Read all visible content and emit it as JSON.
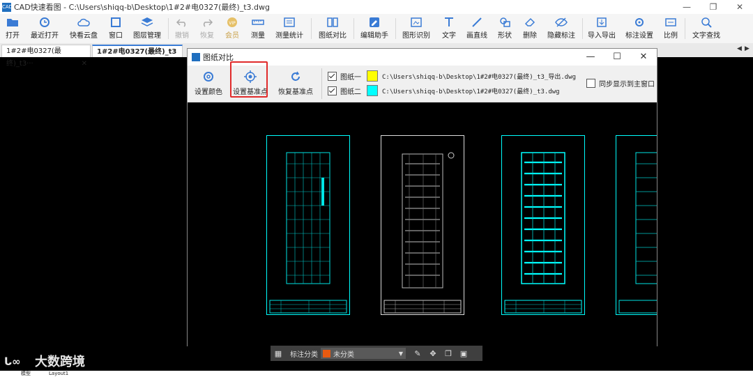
{
  "app": {
    "logo": "CAD",
    "title": "CAD快速看图 - C:\\Users\\shiqq-b\\Desktop\\1#2#电0327(最终)_t3.dwg",
    "window_controls": [
      "—",
      "❐",
      "✕"
    ]
  },
  "toolbar": {
    "open": "打开",
    "recent": "最近打开",
    "cloud": "快看云盘",
    "window": "窗口",
    "layers": "图层管理",
    "undo": "撤销",
    "redo": "恢复",
    "vip": "会员",
    "measure": "测量",
    "measure_stats": "测量统计",
    "compare": "图纸对比",
    "edit_helper": "编辑助手",
    "shape_recog": "图形识别",
    "text": "文字",
    "line": "画直线",
    "shape": "形状",
    "delete": "删除",
    "hide_annot": "隐藏标注",
    "import_export": "导入导出",
    "annot_settings": "标注设置",
    "scale": "比例",
    "text_search": "文字查找"
  },
  "tabs": [
    {
      "label": "1#2#电0327(最终)_t3···",
      "close": "✕"
    },
    {
      "label": "1#2#电0327(最终)_t3",
      "close": "✕"
    }
  ],
  "tab_scroll": [
    "◀",
    "▶"
  ],
  "dialog": {
    "title": "图纸对比",
    "controls": [
      "—",
      "☐",
      "✕"
    ],
    "tools": {
      "set_color": "设置颜色",
      "set_base": "设置基准点",
      "restore_base": "恢复基准点"
    },
    "file1": {
      "label": "图纸一",
      "color": "#ffff00",
      "path": "C:\\Users\\shiqq-b\\Desktop\\1#2#电0327(最终)_t3_导出.dwg"
    },
    "file2": {
      "label": "图纸二",
      "color": "#00ffff",
      "path": "C:\\Users\\shiqq-b\\Desktop\\1#2#电0327(最终)_t3.dwg"
    },
    "sync_label": "同步显示到主窗口"
  },
  "bottom_bar": {
    "category_label": "标注分类",
    "selected": "未分类",
    "selected_color": "#e85a10"
  },
  "status": {
    "left_tab": "模型",
    "layout_tab": "Layout1"
  },
  "watermark": "大数跨境"
}
